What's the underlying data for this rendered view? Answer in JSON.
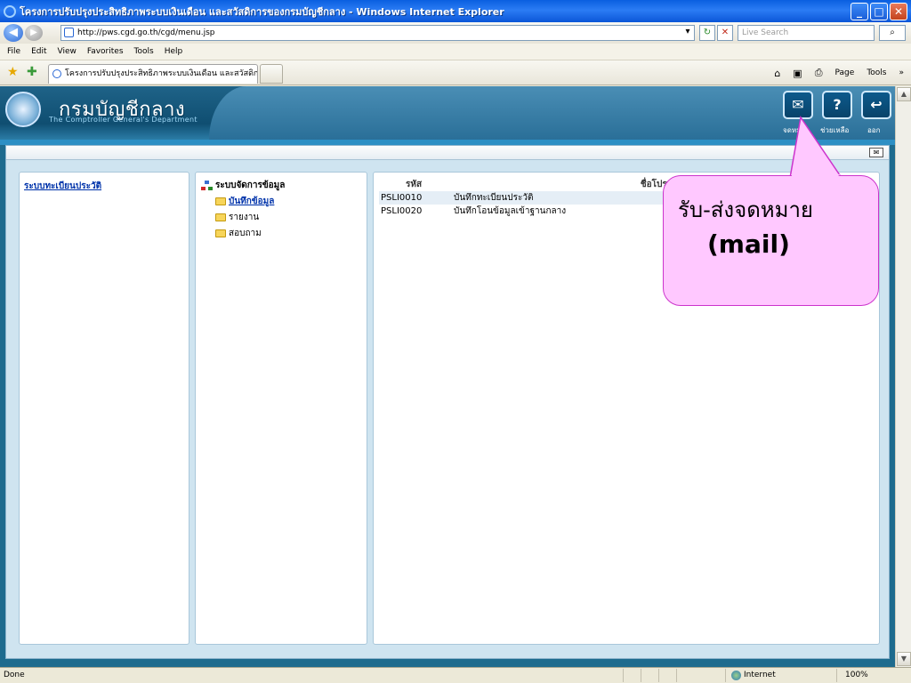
{
  "window": {
    "title": "โครงการปรับปรุงประสิทธิภาพระบบเงินเดือน และสวัสดิการของกรมบัญชีกลาง - Windows Internet Explorer",
    "controls": {
      "minimize": "_",
      "maximize": "□",
      "close": "✕"
    }
  },
  "browser": {
    "back_glyph": "◀",
    "forward_glyph": "▶",
    "url": "http://pws.cgd.go.th/cgd/menu.jsp",
    "dropdown_glyph": "▾",
    "refresh_glyph": "↻",
    "stop_glyph": "✕",
    "search_placeholder": "Live Search",
    "search_go_glyph": "⌕",
    "menu": [
      "File",
      "Edit",
      "View",
      "Favorites",
      "Tools",
      "Help"
    ],
    "tab_title": "โครงการปรับปรุงประสิทธิภาพระบบเงินเดือน และสวัสดิกา...",
    "toolbar": {
      "home": "⌂",
      "feeds": "▣",
      "print": "⎙",
      "page_label": "Page",
      "tools_label": "Tools",
      "more": "»"
    }
  },
  "header": {
    "logo_th": "กรมบัญชีกลาง",
    "logo_en": "The Comptroller General's Department",
    "buttons": [
      {
        "label": "จดหมาย",
        "glyph": "✉"
      },
      {
        "label": "ช่วยเหลือ",
        "glyph": "?"
      },
      {
        "label": "ออก",
        "glyph": "↩"
      }
    ],
    "mail_icon_glyph": "✉"
  },
  "left_panel": {
    "link": "ระบบทะเบียนประวัติ"
  },
  "tree": {
    "root": "ระบบจัดการข้อมูล",
    "nodes": [
      "บันทึกข้อมูล",
      "รายงาน",
      "สอบถาม"
    ]
  },
  "program_table": {
    "headers": [
      "รหัส",
      "ชื่อโปรแกรม"
    ],
    "rows": [
      [
        "PSLI0010",
        "บันทึกทะเบียนประวัติ"
      ],
      [
        "PSLI0020",
        "บันทึกโอนข้อมูลเข้าฐานกลาง"
      ]
    ]
  },
  "annotation": {
    "line1": "รับ-ส่งจดหมาย",
    "line2": "(mail)"
  },
  "status": {
    "text": "Done",
    "zone": "Internet",
    "zoom": "100%"
  }
}
